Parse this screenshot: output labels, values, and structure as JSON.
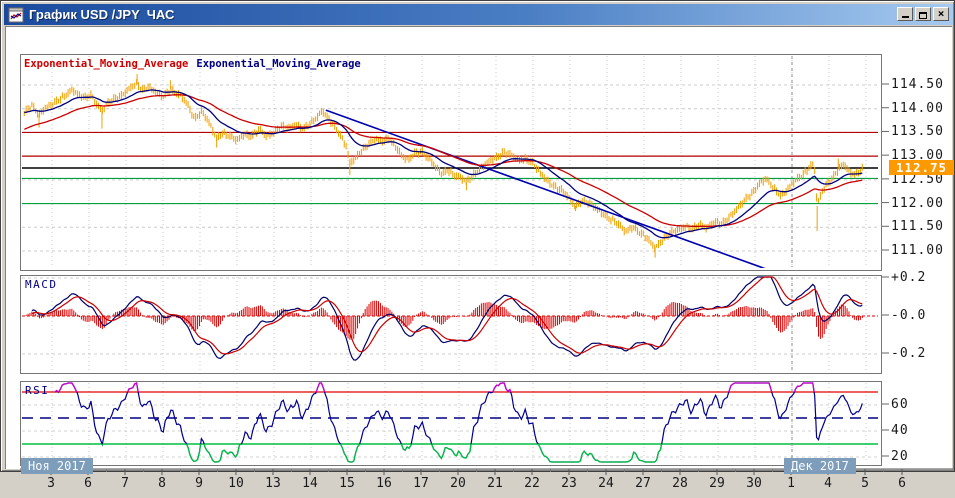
{
  "window": {
    "title": "График USD /JPY  ЧАС",
    "close": "×"
  },
  "legend": {
    "ema1": "Exponential_Moving_Average",
    "ema2": "Exponential_Moving_Average",
    "ema1_color": "#cc0000",
    "ema2_color": "#000080"
  },
  "panels": {
    "macd_label": "MACD",
    "rsi_label": "RSI"
  },
  "price_badge": {
    "value": "112.75",
    "bg": "#ff9900"
  },
  "axes": {
    "price_ticks": [
      "114.50",
      "114.00",
      "113.50",
      "113.00",
      "112.50",
      "112.00",
      "111.50",
      "111.00"
    ],
    "price_tick_values": [
      114.5,
      114.0,
      113.5,
      113.0,
      112.5,
      112.0,
      111.5,
      111.0
    ],
    "macd_ticks": [
      "+0.2",
      "-0.0",
      "-0.2"
    ],
    "macd_tick_values": [
      0.2,
      0,
      -0.2
    ],
    "rsi_ticks": [
      "60",
      "40",
      "20"
    ],
    "rsi_tick_values": [
      60,
      40,
      20
    ],
    "x_labels": [
      "3",
      "6",
      "7",
      "8",
      "9",
      "10",
      "13",
      "14",
      "15",
      "16",
      "17",
      "20",
      "21",
      "22",
      "23",
      "24",
      "27",
      "28",
      "29",
      "30",
      "1",
      "4",
      "5",
      "6"
    ],
    "month_left": "Ноя 2017",
    "month_right": "Дек 2017"
  },
  "chart_data": {
    "type": "candlestick",
    "symbol": "USD/JPY",
    "timeframe": "1H",
    "price_ylim": [
      110.7,
      114.93
    ],
    "close_points": [
      [
        -0.75,
        113.92
      ],
      [
        -0.55,
        114.05
      ],
      [
        -0.35,
        113.88
      ],
      [
        -0.2,
        114.02
      ],
      [
        0,
        114.08
      ],
      [
        0.2,
        114.18
      ],
      [
        0.4,
        114.32
      ],
      [
        0.55,
        114.42
      ],
      [
        0.7,
        114.28
      ],
      [
        0.9,
        114.22
      ],
      [
        1.05,
        114.3
      ],
      [
        1.2,
        114.12
      ],
      [
        1.35,
        113.95
      ],
      [
        1.5,
        114.1
      ],
      [
        1.7,
        114.22
      ],
      [
        1.9,
        114.3
      ],
      [
        2.1,
        114.42
      ],
      [
        2.3,
        114.52
      ],
      [
        2.45,
        114.4
      ],
      [
        2.6,
        114.48
      ],
      [
        2.8,
        114.34
      ],
      [
        3.0,
        114.25
      ],
      [
        3.2,
        114.42
      ],
      [
        3.45,
        114.28
      ],
      [
        3.65,
        114.1
      ],
      [
        3.85,
        113.8
      ],
      [
        4.05,
        113.95
      ],
      [
        4.25,
        113.68
      ],
      [
        4.45,
        113.38
      ],
      [
        4.6,
        113.5
      ],
      [
        4.8,
        113.42
      ],
      [
        5.0,
        113.32
      ],
      [
        5.2,
        113.48
      ],
      [
        5.4,
        113.42
      ],
      [
        5.6,
        113.55
      ],
      [
        5.8,
        113.42
      ],
      [
        6.0,
        113.52
      ],
      [
        6.2,
        113.62
      ],
      [
        6.4,
        113.58
      ],
      [
        6.6,
        113.68
      ],
      [
        6.8,
        113.58
      ],
      [
        7.0,
        113.68
      ],
      [
        7.15,
        113.8
      ],
      [
        7.3,
        113.98
      ],
      [
        7.45,
        113.82
      ],
      [
        7.6,
        113.65
      ],
      [
        7.8,
        113.42
      ],
      [
        7.95,
        113.22
      ],
      [
        8.05,
        112.88
      ],
      [
        8.2,
        112.95
      ],
      [
        8.35,
        113.08
      ],
      [
        8.55,
        113.25
      ],
      [
        8.75,
        113.38
      ],
      [
        8.95,
        113.3
      ],
      [
        9.1,
        113.36
      ],
      [
        9.3,
        113.2
      ],
      [
        9.5,
        112.98
      ],
      [
        9.65,
        112.92
      ],
      [
        9.8,
        113.05
      ],
      [
        10.0,
        113.1
      ],
      [
        10.2,
        112.95
      ],
      [
        10.4,
        112.72
      ],
      [
        10.55,
        112.62
      ],
      [
        10.7,
        112.72
      ],
      [
        10.85,
        112.62
      ],
      [
        11.0,
        112.56
      ],
      [
        11.2,
        112.45
      ],
      [
        11.4,
        112.62
      ],
      [
        11.6,
        112.76
      ],
      [
        11.8,
        112.86
      ],
      [
        12.0,
        112.96
      ],
      [
        12.2,
        113.1
      ],
      [
        12.4,
        113.02
      ],
      [
        12.6,
        112.9
      ],
      [
        12.8,
        112.96
      ],
      [
        13.0,
        112.86
      ],
      [
        13.2,
        112.62
      ],
      [
        13.4,
        112.48
      ],
      [
        13.6,
        112.36
      ],
      [
        13.8,
        112.26
      ],
      [
        14.0,
        112.08
      ],
      [
        14.15,
        111.95
      ],
      [
        14.3,
        112.06
      ],
      [
        14.5,
        112.0
      ],
      [
        14.7,
        111.9
      ],
      [
        14.9,
        111.8
      ],
      [
        15.1,
        111.66
      ],
      [
        15.3,
        111.56
      ],
      [
        15.5,
        111.42
      ],
      [
        15.7,
        111.52
      ],
      [
        15.9,
        111.36
      ],
      [
        16.1,
        111.26
      ],
      [
        16.3,
        111.08
      ],
      [
        16.5,
        111.22
      ],
      [
        16.7,
        111.36
      ],
      [
        16.9,
        111.46
      ],
      [
        17.1,
        111.52
      ],
      [
        17.3,
        111.44
      ],
      [
        17.5,
        111.56
      ],
      [
        17.7,
        111.5
      ],
      [
        17.9,
        111.6
      ],
      [
        18.1,
        111.56
      ],
      [
        18.3,
        111.72
      ],
      [
        18.5,
        111.88
      ],
      [
        18.7,
        112.04
      ],
      [
        18.9,
        112.2
      ],
      [
        19.1,
        112.42
      ],
      [
        19.3,
        112.52
      ],
      [
        19.5,
        112.32
      ],
      [
        19.7,
        112.18
      ],
      [
        19.9,
        112.32
      ],
      [
        20.1,
        112.48
      ],
      [
        20.3,
        112.62
      ],
      [
        20.45,
        112.76
      ],
      [
        20.6,
        112.86
      ],
      [
        20.68,
        111.95
      ],
      [
        20.8,
        112.22
      ],
      [
        20.95,
        112.42
      ],
      [
        21.1,
        112.56
      ],
      [
        21.25,
        112.72
      ],
      [
        21.4,
        112.82
      ],
      [
        21.55,
        112.66
      ],
      [
        21.7,
        112.62
      ],
      [
        21.9,
        112.74
      ]
    ],
    "spikes": [
      [
        -0.35,
        113.6
      ],
      [
        1.35,
        113.58
      ],
      [
        2.3,
        114.73
      ],
      [
        3.2,
        114.6
      ],
      [
        4.45,
        113.18
      ],
      [
        8.05,
        112.6
      ],
      [
        11.2,
        112.28
      ],
      [
        14.15,
        111.84
      ],
      [
        16.3,
        110.86
      ],
      [
        20.68,
        111.42
      ],
      [
        21.25,
        112.95
      ]
    ],
    "hlines": [
      {
        "price": 113.5,
        "color": "#b00000"
      },
      {
        "price": 113.0,
        "color": "#b00000"
      },
      {
        "price": 112.75,
        "color": "#000000"
      },
      {
        "price": 112.53,
        "color": "#00a040"
      },
      {
        "price": 112.0,
        "color": "#00a040"
      }
    ],
    "trendline": {
      "from": [
        7.4,
        113.97
      ],
      "to": [
        19.3,
        110.62
      ],
      "color": "#0000b0"
    },
    "macd": {
      "ylim": [
        -0.32,
        0.25
      ],
      "grid": [
        0.2,
        -0.2
      ],
      "zero_color": "#e00000",
      "line_color": "#000068",
      "signal_color": "#cc0000",
      "hist_color": "#dd0000"
    },
    "rsi": {
      "overbought": 70,
      "mid": 50,
      "oversold": 30,
      "line_color": "#000090",
      "ob_color": "#cc00cc",
      "os_color": "#00c040"
    }
  }
}
